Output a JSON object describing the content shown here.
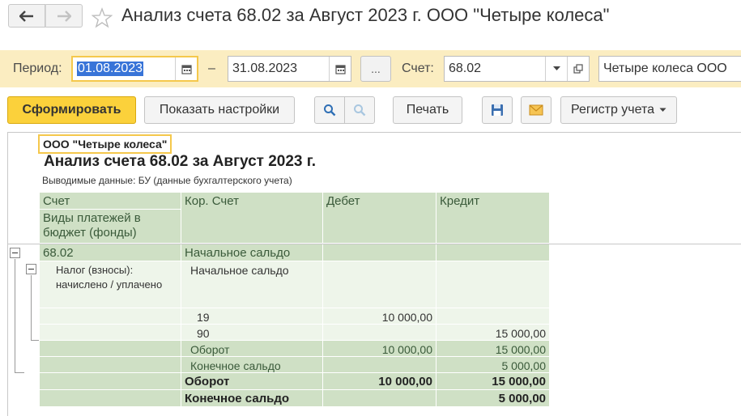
{
  "window": {
    "title": "Анализ счета 68.02 за Август 2023 г. ООО \"Четыре колеса\""
  },
  "filters": {
    "period_label": "Период:",
    "date_from": "01.08.2023",
    "dash": "–",
    "date_to": "31.08.2023",
    "dots_label": "...",
    "account_label": "Счет:",
    "account_value": "68.02",
    "organization_value": "Четыре колеса ООО"
  },
  "toolbar": {
    "generate_label": "Сформировать",
    "settings_label": "Показать настройки",
    "print_label": "Печать",
    "register_label": "Регистр учета"
  },
  "report": {
    "organization": "ООО \"Четыре колеса\"",
    "title": "Анализ счета 68.02 за Август 2023 г.",
    "subtitle": "Выводимые данные: БУ (данные бухгалтерского учета)",
    "headers": {
      "account": "Счет",
      "subconto": "Виды платежей в бюджет (фонды)",
      "corr_account": "Кор. Счет",
      "debit": "Дебет",
      "credit": "Кредит"
    },
    "rows": [
      {
        "c1": "68.02",
        "c2": "Начальное сальдо",
        "debit": "",
        "credit": ""
      },
      {
        "c1": "Налог (взносы): начислено / уплачено",
        "c2": "Начальное сальдо",
        "debit": "",
        "credit": ""
      },
      {
        "c1": "",
        "c2": "19",
        "debit": "10 000,00",
        "credit": ""
      },
      {
        "c1": "",
        "c2": "90",
        "debit": "",
        "credit": "15 000,00"
      },
      {
        "c1": "",
        "c2": "Оборот",
        "debit": "10 000,00",
        "credit": "15 000,00"
      },
      {
        "c1": "",
        "c2": "Конечное сальдо",
        "debit": "",
        "credit": "5 000,00"
      },
      {
        "c1": "",
        "c2": "Оборот",
        "debit": "10 000,00",
        "credit": "15 000,00"
      },
      {
        "c1": "",
        "c2": "Конечное сальдо",
        "debit": "",
        "credit": "5 000,00"
      }
    ]
  },
  "colors": {
    "filter_panel": "#fbedc1",
    "primary_button": "#fbd13b",
    "header_cell": "#cfe0c5",
    "body_cell": "#eef5ea",
    "focus_border": "#f5c84c",
    "selection": "#3874d8"
  },
  "icons": [
    "back-arrow-icon",
    "forward-arrow-icon",
    "star-icon",
    "calendar-icon",
    "dropdown-icon",
    "open-link-icon",
    "search-icon",
    "search-cancel-icon",
    "save-icon",
    "email-icon",
    "chevron-down-icon"
  ]
}
